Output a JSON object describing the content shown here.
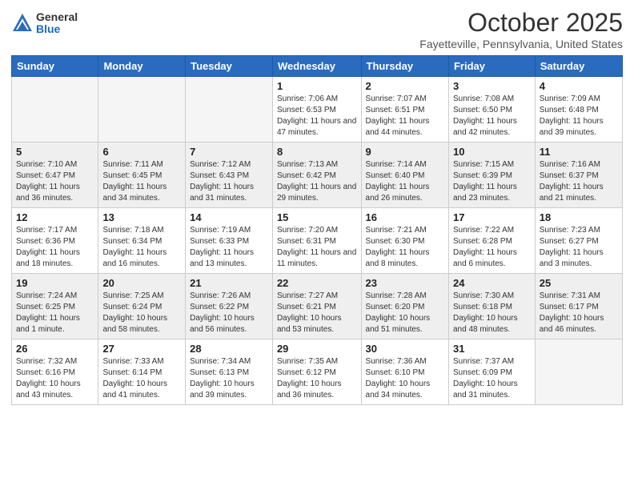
{
  "logo": {
    "general": "General",
    "blue": "Blue"
  },
  "header": {
    "month": "October 2025",
    "location": "Fayetteville, Pennsylvania, United States"
  },
  "days_of_week": [
    "Sunday",
    "Monday",
    "Tuesday",
    "Wednesday",
    "Thursday",
    "Friday",
    "Saturday"
  ],
  "weeks": [
    [
      {
        "day": "",
        "info": ""
      },
      {
        "day": "",
        "info": ""
      },
      {
        "day": "",
        "info": ""
      },
      {
        "day": "1",
        "info": "Sunrise: 7:06 AM\nSunset: 6:53 PM\nDaylight: 11 hours\nand 47 minutes."
      },
      {
        "day": "2",
        "info": "Sunrise: 7:07 AM\nSunset: 6:51 PM\nDaylight: 11 hours\nand 44 minutes."
      },
      {
        "day": "3",
        "info": "Sunrise: 7:08 AM\nSunset: 6:50 PM\nDaylight: 11 hours\nand 42 minutes."
      },
      {
        "day": "4",
        "info": "Sunrise: 7:09 AM\nSunset: 6:48 PM\nDaylight: 11 hours\nand 39 minutes."
      }
    ],
    [
      {
        "day": "5",
        "info": "Sunrise: 7:10 AM\nSunset: 6:47 PM\nDaylight: 11 hours\nand 36 minutes."
      },
      {
        "day": "6",
        "info": "Sunrise: 7:11 AM\nSunset: 6:45 PM\nDaylight: 11 hours\nand 34 minutes."
      },
      {
        "day": "7",
        "info": "Sunrise: 7:12 AM\nSunset: 6:43 PM\nDaylight: 11 hours\nand 31 minutes."
      },
      {
        "day": "8",
        "info": "Sunrise: 7:13 AM\nSunset: 6:42 PM\nDaylight: 11 hours\nand 29 minutes."
      },
      {
        "day": "9",
        "info": "Sunrise: 7:14 AM\nSunset: 6:40 PM\nDaylight: 11 hours\nand 26 minutes."
      },
      {
        "day": "10",
        "info": "Sunrise: 7:15 AM\nSunset: 6:39 PM\nDaylight: 11 hours\nand 23 minutes."
      },
      {
        "day": "11",
        "info": "Sunrise: 7:16 AM\nSunset: 6:37 PM\nDaylight: 11 hours\nand 21 minutes."
      }
    ],
    [
      {
        "day": "12",
        "info": "Sunrise: 7:17 AM\nSunset: 6:36 PM\nDaylight: 11 hours\nand 18 minutes."
      },
      {
        "day": "13",
        "info": "Sunrise: 7:18 AM\nSunset: 6:34 PM\nDaylight: 11 hours\nand 16 minutes."
      },
      {
        "day": "14",
        "info": "Sunrise: 7:19 AM\nSunset: 6:33 PM\nDaylight: 11 hours\nand 13 minutes."
      },
      {
        "day": "15",
        "info": "Sunrise: 7:20 AM\nSunset: 6:31 PM\nDaylight: 11 hours\nand 11 minutes."
      },
      {
        "day": "16",
        "info": "Sunrise: 7:21 AM\nSunset: 6:30 PM\nDaylight: 11 hours\nand 8 minutes."
      },
      {
        "day": "17",
        "info": "Sunrise: 7:22 AM\nSunset: 6:28 PM\nDaylight: 11 hours\nand 6 minutes."
      },
      {
        "day": "18",
        "info": "Sunrise: 7:23 AM\nSunset: 6:27 PM\nDaylight: 11 hours\nand 3 minutes."
      }
    ],
    [
      {
        "day": "19",
        "info": "Sunrise: 7:24 AM\nSunset: 6:25 PM\nDaylight: 11 hours\nand 1 minute."
      },
      {
        "day": "20",
        "info": "Sunrise: 7:25 AM\nSunset: 6:24 PM\nDaylight: 10 hours\nand 58 minutes."
      },
      {
        "day": "21",
        "info": "Sunrise: 7:26 AM\nSunset: 6:22 PM\nDaylight: 10 hours\nand 56 minutes."
      },
      {
        "day": "22",
        "info": "Sunrise: 7:27 AM\nSunset: 6:21 PM\nDaylight: 10 hours\nand 53 minutes."
      },
      {
        "day": "23",
        "info": "Sunrise: 7:28 AM\nSunset: 6:20 PM\nDaylight: 10 hours\nand 51 minutes."
      },
      {
        "day": "24",
        "info": "Sunrise: 7:30 AM\nSunset: 6:18 PM\nDaylight: 10 hours\nand 48 minutes."
      },
      {
        "day": "25",
        "info": "Sunrise: 7:31 AM\nSunset: 6:17 PM\nDaylight: 10 hours\nand 46 minutes."
      }
    ],
    [
      {
        "day": "26",
        "info": "Sunrise: 7:32 AM\nSunset: 6:16 PM\nDaylight: 10 hours\nand 43 minutes."
      },
      {
        "day": "27",
        "info": "Sunrise: 7:33 AM\nSunset: 6:14 PM\nDaylight: 10 hours\nand 41 minutes."
      },
      {
        "day": "28",
        "info": "Sunrise: 7:34 AM\nSunset: 6:13 PM\nDaylight: 10 hours\nand 39 minutes."
      },
      {
        "day": "29",
        "info": "Sunrise: 7:35 AM\nSunset: 6:12 PM\nDaylight: 10 hours\nand 36 minutes."
      },
      {
        "day": "30",
        "info": "Sunrise: 7:36 AM\nSunset: 6:10 PM\nDaylight: 10 hours\nand 34 minutes."
      },
      {
        "day": "31",
        "info": "Sunrise: 7:37 AM\nSunset: 6:09 PM\nDaylight: 10 hours\nand 31 minutes."
      },
      {
        "day": "",
        "info": ""
      }
    ]
  ]
}
